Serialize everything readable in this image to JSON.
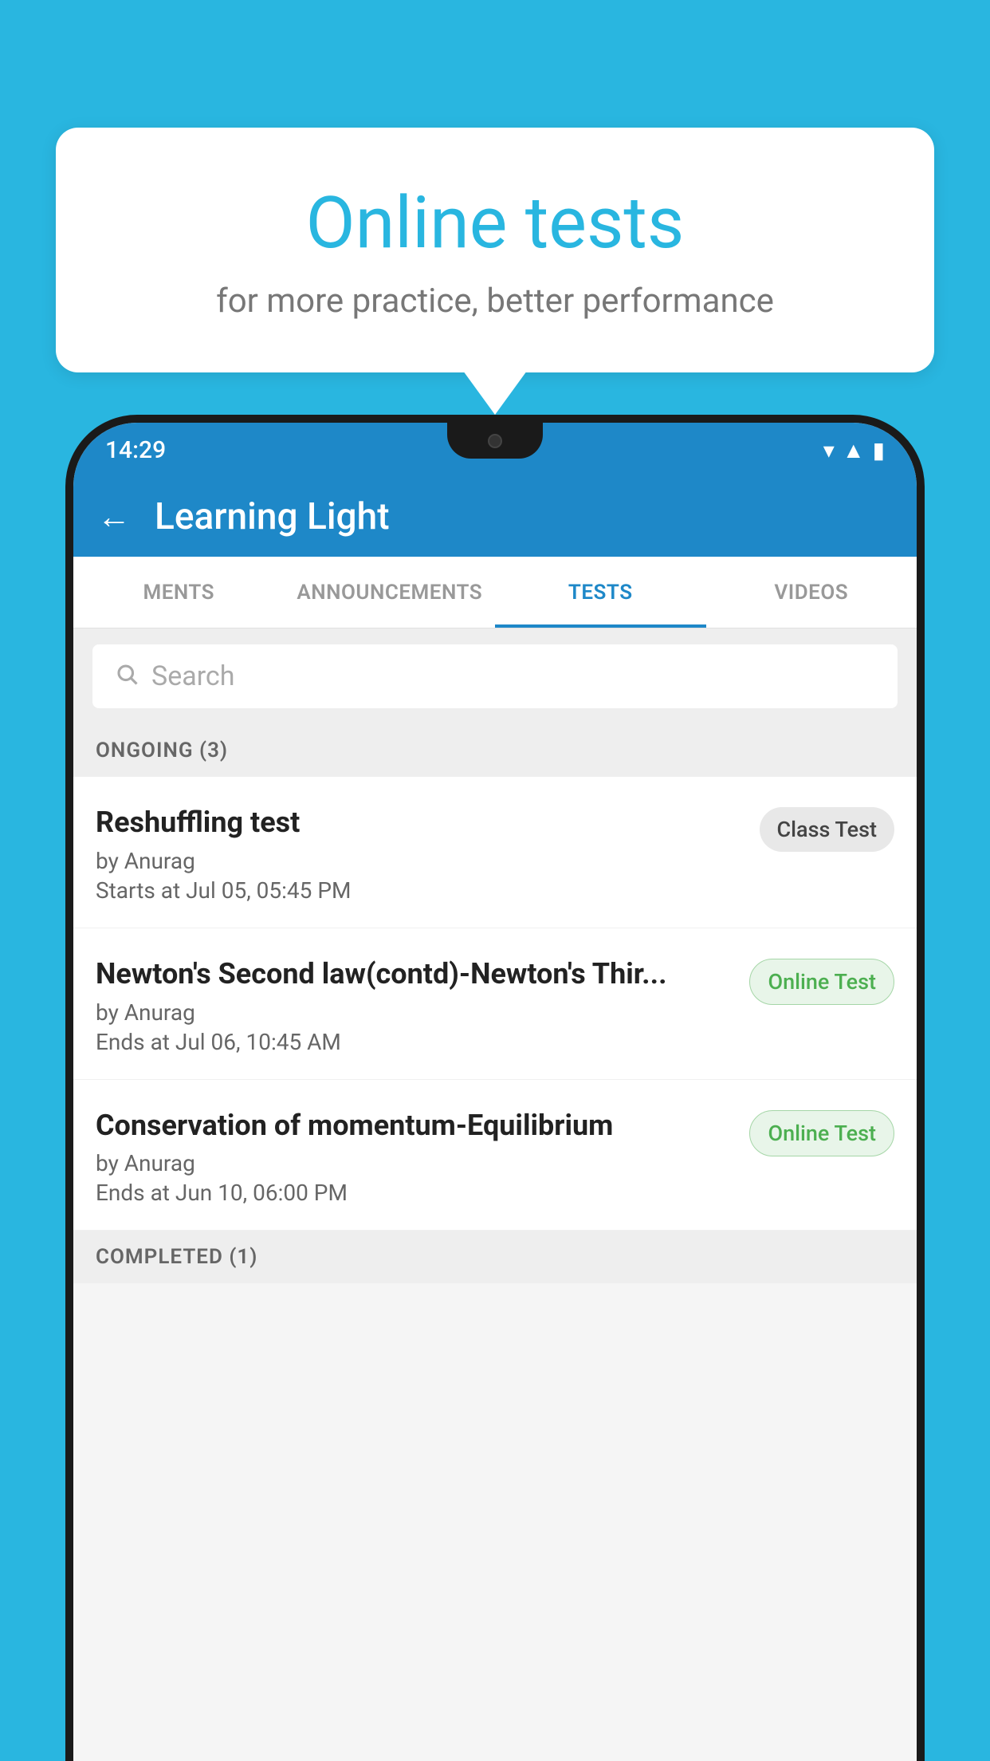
{
  "background_color": "#29b6e0",
  "bubble": {
    "title": "Online tests",
    "subtitle": "for more practice, better performance"
  },
  "status_bar": {
    "time": "14:29",
    "icons": [
      "wifi",
      "signal",
      "battery"
    ]
  },
  "app_bar": {
    "back_label": "←",
    "title": "Learning Light"
  },
  "tabs": [
    {
      "label": "MENTS",
      "active": false
    },
    {
      "label": "ANNOUNCEMENTS",
      "active": false
    },
    {
      "label": "TESTS",
      "active": true
    },
    {
      "label": "VIDEOS",
      "active": false
    }
  ],
  "search": {
    "placeholder": "Search"
  },
  "ongoing_section": {
    "label": "ONGOING (3)"
  },
  "tests": [
    {
      "title": "Reshuffling test",
      "author": "by Anurag",
      "date": "Starts at  Jul 05, 05:45 PM",
      "badge": "Class Test",
      "badge_type": "class"
    },
    {
      "title": "Newton's Second law(contd)-Newton's Thir...",
      "author": "by Anurag",
      "date": "Ends at  Jul 06, 10:45 AM",
      "badge": "Online Test",
      "badge_type": "online"
    },
    {
      "title": "Conservation of momentum-Equilibrium",
      "author": "by Anurag",
      "date": "Ends at  Jun 10, 06:00 PM",
      "badge": "Online Test",
      "badge_type": "online"
    }
  ],
  "completed_section": {
    "label": "COMPLETED (1)"
  }
}
